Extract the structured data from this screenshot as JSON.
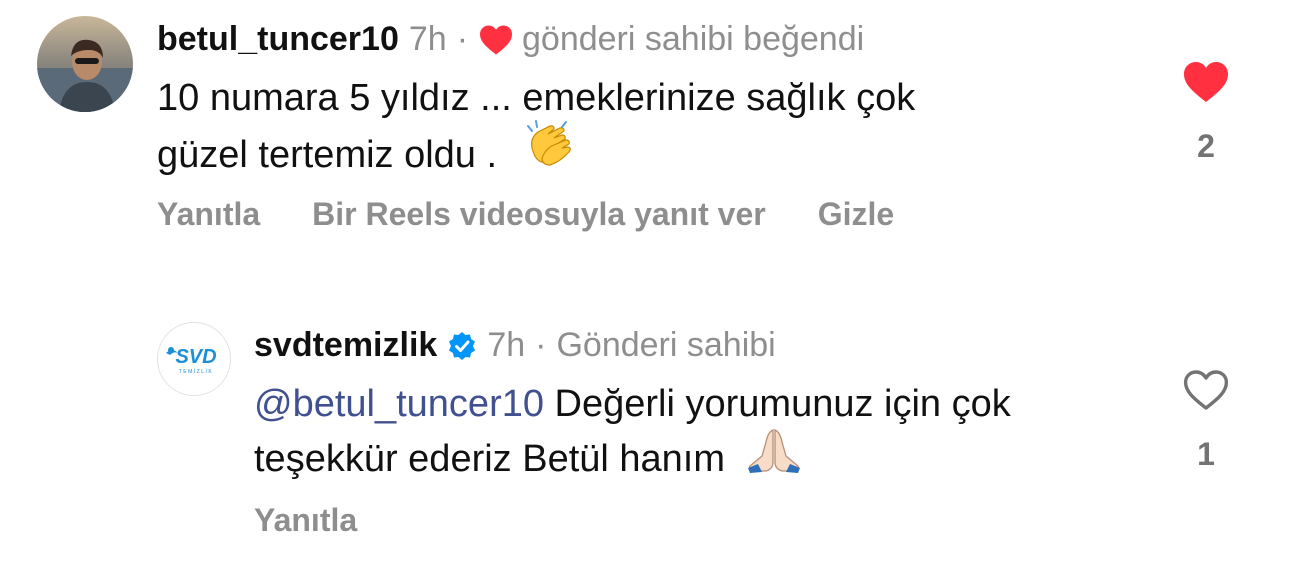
{
  "comment": {
    "username": "betul_tuncer10",
    "time": "7h",
    "separator": "·",
    "owner_liked_label": "gönderi sahibi beğendi",
    "text_line1": "10 numara 5 yıldız ... emeklerinize sağlık çok",
    "text_line2": "güzel  tertemiz  oldu .",
    "emoji": "clapping-hands",
    "actions": {
      "reply": "Yanıtla",
      "reels_reply": "Bir Reels videosuyla yanıt ver",
      "hide": "Gizle"
    },
    "like_count": "2",
    "liked": true
  },
  "reply": {
    "username": "svdtemizlik",
    "verified": true,
    "time": "7h",
    "separator": "·",
    "owner_label": "Gönderi sahibi",
    "mention": "@betul_tuncer10",
    "text_line1": " Değerli yorumunuz için çok",
    "text_line2": "teşekkür ederiz Betül hanım",
    "emoji": "folded-hands",
    "actions": {
      "reply": "Yanıtla"
    },
    "like_count": "1",
    "liked": false,
    "avatar_logo_text": "SVD",
    "avatar_logo_subtext": "TEMİZLİK"
  },
  "colors": {
    "heart_red": "#ff3040",
    "muted_text": "#8e8e8e",
    "mention_blue": "#41508f",
    "verified_blue": "#0095f6",
    "logo_blue": "#1d8ed8"
  }
}
